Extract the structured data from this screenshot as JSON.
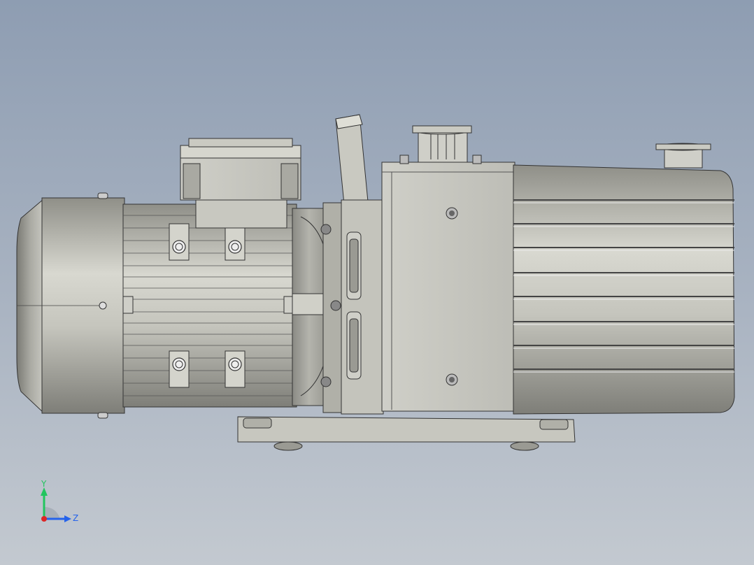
{
  "viewport": {
    "background_top": "#8e9db2",
    "background_bottom": "#c3c9d0"
  },
  "model": {
    "body_color": "#c9c9c2",
    "shadow_color": "#8f8f88",
    "edge_color": "#3a3a3a"
  },
  "triad": {
    "y_label": "Y",
    "z_label": "Z",
    "y_color": "#22c55e",
    "z_color": "#2563eb",
    "x_color": "#dc2626"
  }
}
